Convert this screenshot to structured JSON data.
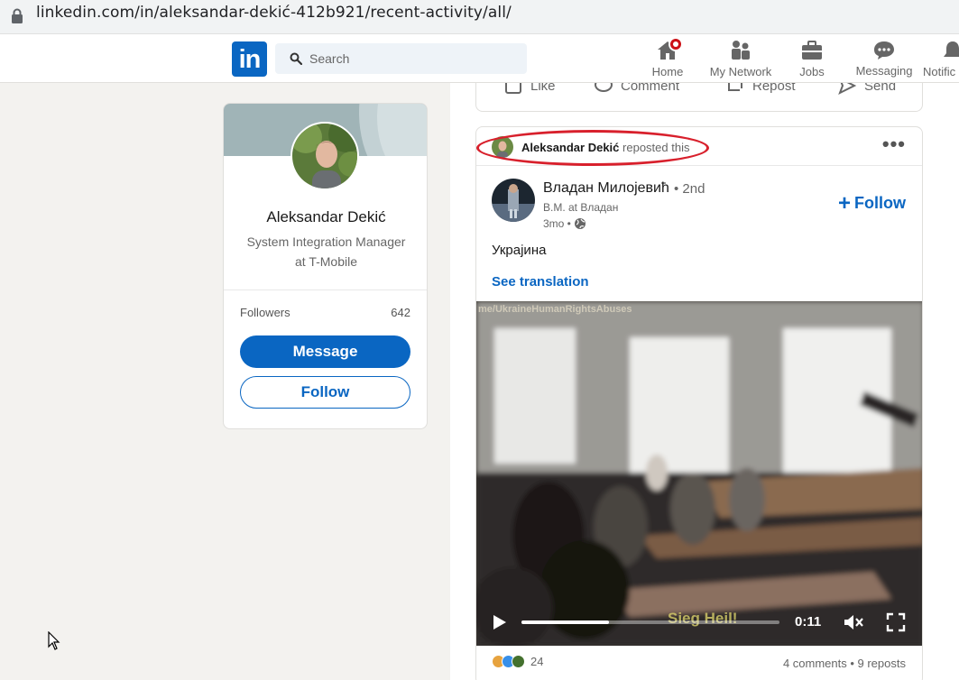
{
  "browser": {
    "url": "linkedin.com/in/aleksandar-dekić-412b921/recent-activity/all/"
  },
  "navbar": {
    "logo": "in",
    "search_placeholder": "Search",
    "items": [
      {
        "label": "Home"
      },
      {
        "label": "My Network"
      },
      {
        "label": "Jobs"
      },
      {
        "label": "Messaging"
      },
      {
        "label": "Notific"
      }
    ]
  },
  "profile": {
    "name": "Aleksandar Dekić",
    "headline": "System Integration Manager at T-Mobile",
    "followers_label": "Followers",
    "followers_count": "642",
    "message_label": "Message",
    "follow_label": "Follow"
  },
  "previous_post_actions": {
    "like": "Like",
    "comment": "Comment",
    "repost": "Repost",
    "send": "Send"
  },
  "post": {
    "reposter_name": "Aleksandar Dekić",
    "reposted_text": "reposted this",
    "more_label": "•••",
    "author_name": "Владан Милојевић",
    "author_degree": "• 2nd",
    "author_desc": "B.M. at Владан",
    "time": "3mo •",
    "follow_label": "Follow",
    "text": "Украјина",
    "see_translation": "See translation",
    "video": {
      "overlay_url": "me/UkraineHumanRightsAbuses",
      "caption": "Sieg Heil!",
      "current_time": "0:11",
      "progress": 0.34
    },
    "reaction_count": "24",
    "stats": "4 comments • 9 reposts"
  },
  "colors": {
    "linkedin_blue": "#0a66c2",
    "highlight_red": "#d8202c",
    "notification_red": "#cc1016"
  }
}
